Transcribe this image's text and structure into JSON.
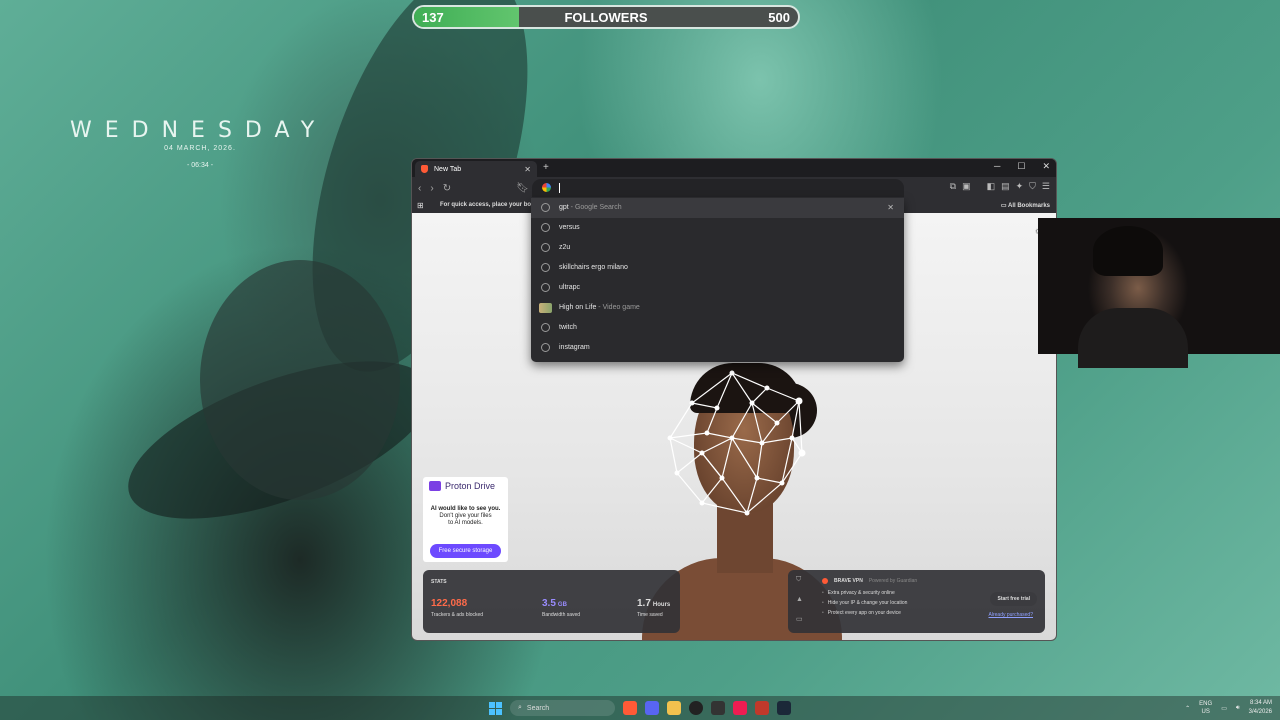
{
  "overlay": {
    "followers_current": "137",
    "followers_label": "FOLLOWERS",
    "followers_goal": "500",
    "progress_fraction": 0.274
  },
  "desktop_clock": {
    "day": "WEDNESDAY",
    "date": "04 MARCH, 2026.",
    "time": "- 06:34 -"
  },
  "browser": {
    "tab_title": "New Tab",
    "bookmarks_hint": "For quick access, place your bookm",
    "all_bookmarks": "All Bookmarks",
    "suggestions": [
      {
        "text": "gpt",
        "sub": " - Google Search",
        "icon": "history-icon"
      },
      {
        "text": "versus",
        "sub": "",
        "icon": "history-icon"
      },
      {
        "text": "z2u",
        "sub": "",
        "icon": "history-icon"
      },
      {
        "text": "skillchairs ergo milano",
        "sub": "",
        "icon": "history-icon"
      },
      {
        "text": "ultrapc",
        "sub": "",
        "icon": "history-icon"
      },
      {
        "text": "High on Life",
        "sub": " - Video game",
        "icon": "game-thumbnail"
      },
      {
        "text": "twitch",
        "sub": "",
        "icon": "history-icon"
      },
      {
        "text": "instagram",
        "sub": "",
        "icon": "history-icon"
      }
    ]
  },
  "proton_ad": {
    "brand": "Proton Drive",
    "line1": "AI would like to see you.",
    "line2": "Don't give your files",
    "line3": "to AI models.",
    "button": "Free secure storage",
    "brand_color": "#6d4aff"
  },
  "stats": {
    "title": "STATS",
    "items": [
      {
        "value": "122,088",
        "unit": "",
        "label": "Trackers & ads blocked",
        "color": "#ff6b4a"
      },
      {
        "value": "3.5",
        "unit": "GB",
        "label": "Bandwidth saved",
        "color": "#9a8cff"
      },
      {
        "value": "1.7",
        "unit": "Hours",
        "label": "Time saved",
        "color": "#ffffff"
      }
    ]
  },
  "vpn": {
    "title": "BRAVE VPN",
    "powered": "Powered by Guardian",
    "features": [
      "Extra privacy & security online",
      "Hide your IP & change your location",
      "Protect every app on your device"
    ],
    "trial_button": "Start free trial",
    "already": "Already purchased?"
  },
  "taskbar": {
    "search_placeholder": "Search",
    "lang": "ENG",
    "region": "US",
    "time": "8:34 AM",
    "date": "3/4/2026"
  }
}
